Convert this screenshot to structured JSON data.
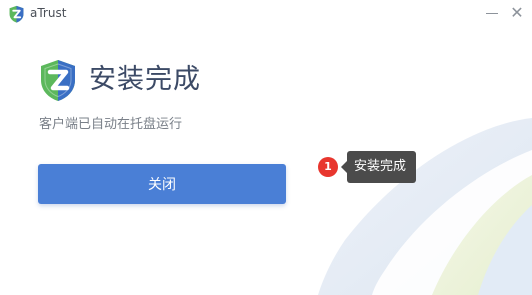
{
  "window": {
    "app_title": "aTrust",
    "minimize_icon": "minimize-icon",
    "close_icon": "close-icon",
    "close_glyph": "✕"
  },
  "main": {
    "heading": "安装完成",
    "subtext": "客户端已自动在托盘运行",
    "close_button_label": "关闭"
  },
  "annotation": {
    "badge_number": "1",
    "tooltip_text": "安装完成"
  },
  "colors": {
    "accent": "#4a7fd6",
    "heading": "#3c4a66",
    "badge": "#e8362e",
    "tooltip_bg": "#4b4b4b",
    "logo_green": "#5cb85c",
    "logo_blue": "#3a6fc4"
  }
}
